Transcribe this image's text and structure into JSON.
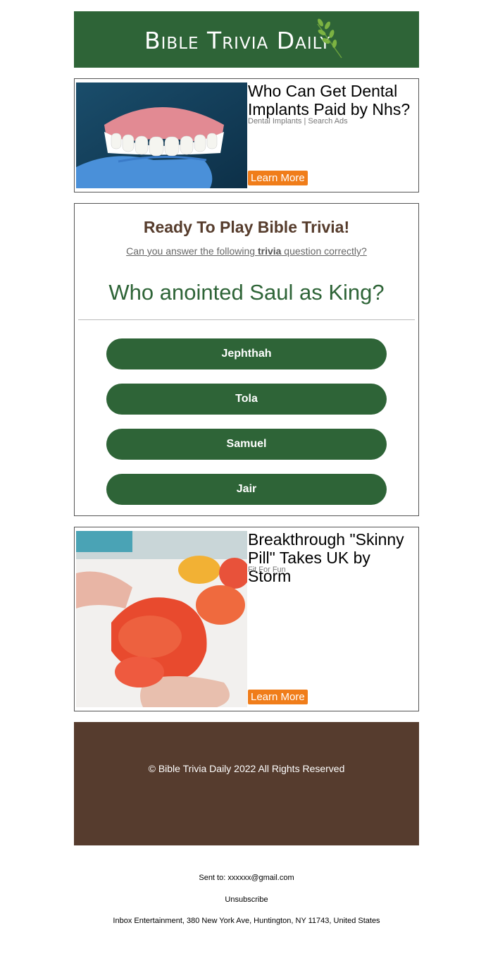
{
  "header": {
    "logo_text": "Bible Trivia Daily",
    "brand_color": "#2e6437",
    "leaf_icon": "leaf-icon"
  },
  "ad_top": {
    "title": "Who Can Get Dental Implants Paid by Nhs?",
    "source": "Dental Implants | Search Ads",
    "button": "Learn More",
    "image": "dentures-image"
  },
  "quiz": {
    "heading": "Ready To Play Bible Trivia!",
    "subtitle_pre": "Can you answer the following ",
    "subtitle_bold": "trivia",
    "subtitle_post": " question correctly?",
    "question": "Who anointed Saul as King?",
    "answers": [
      "Jephthah",
      "Tola",
      "Samuel",
      "Jair"
    ]
  },
  "ad_bottom": {
    "title": "Breakthrough \"Skinny Pill\" Takes UK by Storm",
    "source": "Fit For Fun",
    "button": "Learn More",
    "image": "gummies-image"
  },
  "footer": {
    "copyright": "© Bible Trivia Daily 2022 All Rights Reserved",
    "color": "#563c2e"
  },
  "meta": {
    "sent_to": "Sent to: xxxxxx@gmail.com",
    "unsubscribe": "Unsubscribe",
    "address": "Inbox Entertainment, 380 New York Ave, Huntington, NY 11743, United States"
  },
  "accent_color": "#f07d1a"
}
